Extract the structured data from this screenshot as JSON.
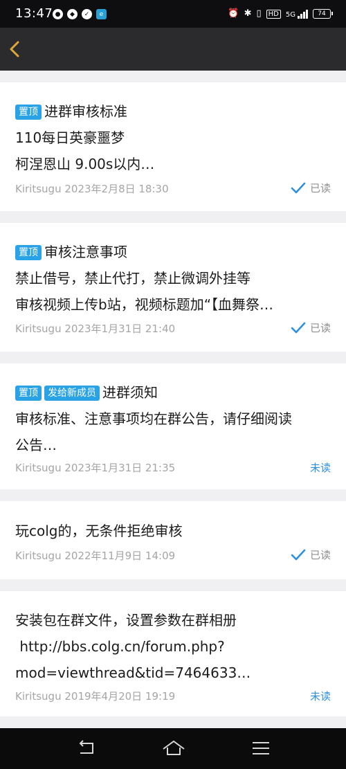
{
  "status_bar": {
    "time": "13:47",
    "left_icons": [
      "wechat-icon",
      "notification-icon",
      "app-icon",
      "store-icon"
    ],
    "right_icons": [
      "alarm-icon",
      "bluetooth-icon",
      "vibrate-icon",
      "hd-icon",
      "5g-signal-icon"
    ],
    "hd_label": "HD",
    "net_label": "5G",
    "battery": "74"
  },
  "nav": {
    "back_icon": "chevron-left-icon"
  },
  "announcements": [
    {
      "tags": [
        "置顶"
      ],
      "title": "进群审核标准",
      "lines": [
        "110每日英豪噩梦",
        "柯涅恩山 9.00s以内…"
      ],
      "author": "Kiritsugu",
      "date": "2023年2月8日 18:30",
      "status": "已读",
      "is_read": true
    },
    {
      "tags": [
        "置顶"
      ],
      "title": "审核注意事项",
      "lines": [
        "禁止借号，禁止代打，禁止微调外挂等",
        "审核视频上传b站，视频标题加“【血舞祭…"
      ],
      "author": "Kiritsugu",
      "date": "2023年1月31日 21:40",
      "status": "已读",
      "is_read": true
    },
    {
      "tags": [
        "置顶",
        "发给新成员"
      ],
      "title": "进群须知",
      "lines": [
        "审核标准、注意事项均在群公告，请仔细阅读",
        "公告…"
      ],
      "author": "Kiritsugu",
      "date": "2023年1月31日 21:35",
      "status": "未读",
      "is_read": false
    },
    {
      "tags": [],
      "title": "玩colg的，无条件拒绝审核",
      "lines": [],
      "author": "Kiritsugu",
      "date": "2022年11月9日 14:09",
      "status": "已读",
      "is_read": true
    },
    {
      "tags": [],
      "title": "安装包在群文件，设置参数在群相册",
      "lines": [
        " http://bbs.colg.cn/forum.php?",
        "mod=viewthread&tid=7464633…"
      ],
      "author": "Kiritsugu",
      "date": "2019年4月20日 19:19",
      "status": "未读",
      "is_read": false
    }
  ],
  "colors": {
    "tag": "#2aa3e6",
    "unread": "#2d8fe0",
    "read_check": "#2d8fe0",
    "meta": "#a5a5a8"
  },
  "system_nav": {
    "icons": [
      "back-icon",
      "home-icon",
      "menu-icon"
    ]
  }
}
